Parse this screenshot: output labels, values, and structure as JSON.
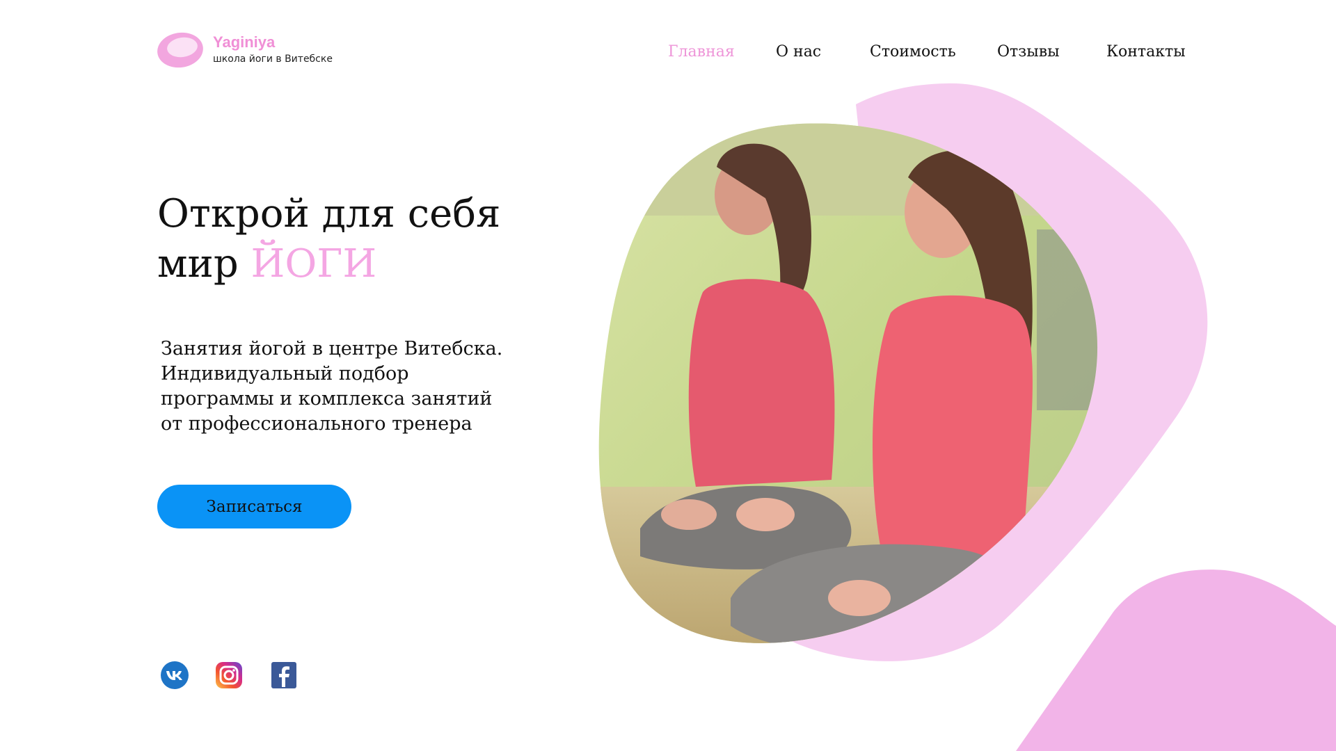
{
  "brand": {
    "name": "Yaginiya",
    "tagline": "школа йоги в Витебске"
  },
  "nav": {
    "items": [
      {
        "label": "Главная",
        "active": true
      },
      {
        "label": "О нас",
        "active": false
      },
      {
        "label": "Стоимость",
        "active": false
      },
      {
        "label": "Отзывы",
        "active": false
      },
      {
        "label": "Контакты",
        "active": false
      }
    ]
  },
  "hero": {
    "title_line1": "Открой для себя",
    "title_line2_prefix": "мир",
    "title_line2_accent": "ЙОГИ",
    "description_lines": [
      "Занятия йогой в центре Витебска.",
      "Индивидуальный подбор",
      "программы и комплекса занятий",
      "от профессионального тренера"
    ],
    "cta_label": "Записаться"
  },
  "social": {
    "vk_icon": "vk-icon",
    "instagram_icon": "instagram-icon",
    "facebook_icon": "facebook-icon"
  },
  "colors": {
    "accent_pink": "#f4a6e3",
    "nav_active": "#ee95d8",
    "cta_blue": "#0a93f6",
    "shape_light_pink": "#f6cdf0",
    "shape_pink": "#f2b4e8"
  }
}
